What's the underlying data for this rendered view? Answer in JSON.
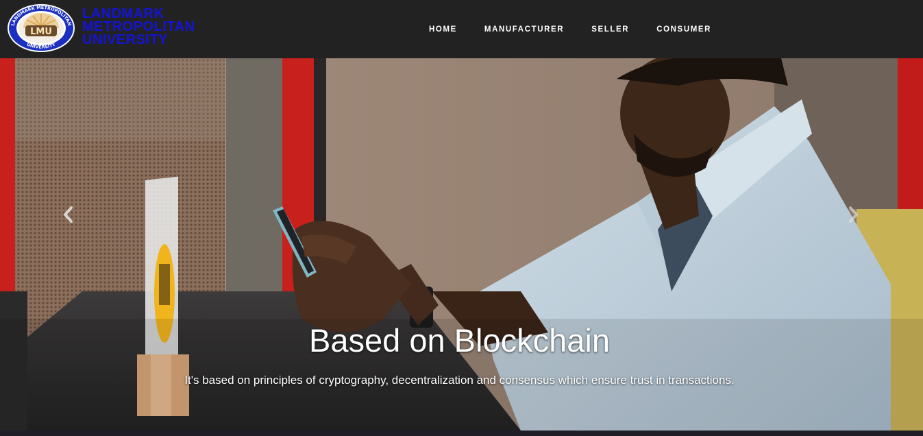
{
  "header": {
    "brand": {
      "line1": "LANDMARK",
      "line2": "METROPOLITAN",
      "line3": "UNIVERSITY",
      "logo_text": "LMU",
      "logo_ring_top": "LANDMARK METROPOLITAN",
      "logo_ring_bottom": "UNIVERSITY",
      "color": "#1414d6"
    },
    "nav": [
      {
        "label": "HOME"
      },
      {
        "label": "MANUFACTURER"
      },
      {
        "label": "SELLER"
      },
      {
        "label": "CONSUMER"
      }
    ]
  },
  "carousel": {
    "slide": {
      "title": "Based on Blockchain",
      "text": "It's based on principles of cryptography, decentralization and consensus which ensure trust in transactions."
    },
    "controls": {
      "prev_icon": "chevron-left-icon",
      "next_icon": "chevron-right-icon"
    }
  },
  "colors": {
    "navbar_bg": "#222222",
    "nav_text": "#ffffff",
    "brand_blue": "#1414d6"
  }
}
